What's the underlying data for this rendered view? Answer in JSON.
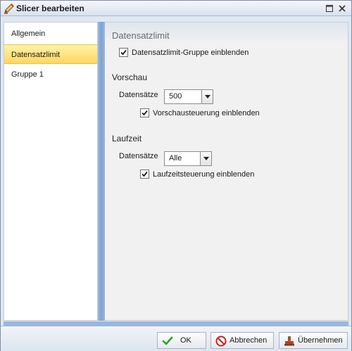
{
  "window": {
    "title": "Slicer bearbeiten"
  },
  "sidebar": {
    "items": [
      {
        "label": "Allgemein",
        "active": false
      },
      {
        "label": "Datensatzlimit",
        "active": true
      },
      {
        "label": "Gruppe 1",
        "active": false
      }
    ]
  },
  "content": {
    "header": "Datensatzlimit",
    "group_checkbox": {
      "label": "Datensatzlimit-Gruppe einblenden",
      "checked": true
    },
    "preview": {
      "title": "Vorschau",
      "records_label": "Datensätze",
      "records_value": "500",
      "control_checkbox": {
        "label": "Vorschausteuerung einblenden",
        "checked": true
      }
    },
    "runtime": {
      "title": "Laufzeit",
      "records_label": "Datensätze",
      "records_value": "Alle",
      "control_checkbox": {
        "label": "Laufzeitsteuerung einblenden",
        "checked": true
      }
    }
  },
  "footer": {
    "ok_label": "OK",
    "cancel_label": "Abbrechen",
    "apply_label": "Übernehmen"
  },
  "icons": {
    "title": "pencil-icon",
    "maximize": "maximize-icon",
    "close": "close-icon",
    "ok": "checkmark-icon",
    "cancel": "cancel-icon",
    "apply": "stamp-icon"
  },
  "colors": {
    "selection": "#ffd660",
    "splitter": "#7fa2d1",
    "ok_green": "#2e9e2e",
    "cancel_red": "#d02020"
  }
}
